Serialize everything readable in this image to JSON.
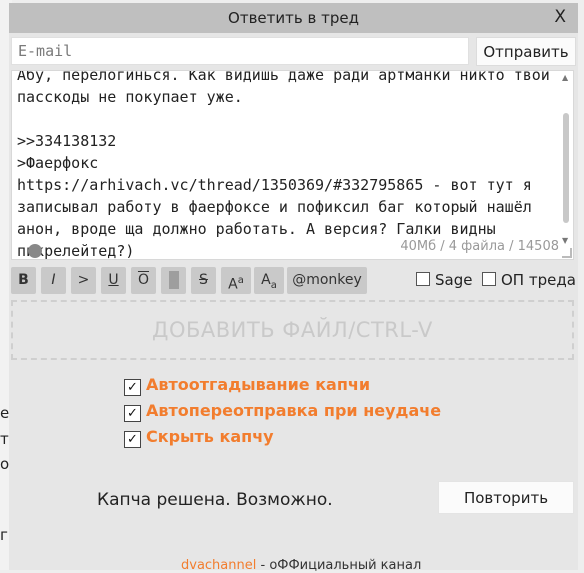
{
  "background_fragments": [
    "е",
    "т",
    "о",
    "г"
  ],
  "dialog": {
    "title": "Ответить в тред",
    "close_label": "X"
  },
  "form": {
    "email_placeholder": "E-mail",
    "send_label": "Отправить",
    "message_text": "Абу, перелогинься. Как видишь даже ради артманки никто твои пасскоды не покупает уже.\n\n>>334138132\n>Фаерфокс\nhttps://arhivach.vc/thread/1350369/#332795865 - вот тут я записывал работу в фаерфоксе и пофиксил баг который нашёл анон, вроде ща должно работать. А версия? Галки видны пикрелейтед?)",
    "counter": "40Мб / 4 файла / 14508"
  },
  "toolbar": {
    "bold": "B",
    "italic": "I",
    "quote": ">",
    "underline": "U",
    "overline": "O",
    "strike": "S",
    "sup_base": "A",
    "sup_small": "a",
    "sub_base": "A",
    "sub_small": "a",
    "mention": "@monkey",
    "sage_label": "Sage",
    "op_label": "ОП треда"
  },
  "dropzone_label": "ДОБАВИТЬ ФАЙЛ/CTRL-V",
  "options": [
    {
      "label": "Автоотгадывание капчи",
      "checked": true
    },
    {
      "label": "Автопереотправка при неудаче",
      "checked": true
    },
    {
      "label": "Скрыть капчу",
      "checked": true
    }
  ],
  "captcha": {
    "status": "Капча решена. Возможно.",
    "retry_label": "Повторить"
  },
  "footer": {
    "link": "dvachannel",
    "text": " - оФФициальный канал"
  },
  "colors": {
    "accent": "#f27d2e",
    "titlebar": "#bfbfbf",
    "panel": "#e6e6e6"
  }
}
